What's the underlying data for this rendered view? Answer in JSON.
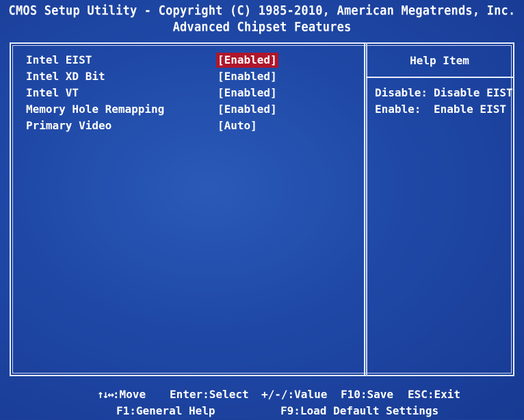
{
  "header": {
    "title_line1": "CMOS Setup Utility - Copyright (C) 1985-2010, American Megatrends, Inc.",
    "title_line2": "Advanced Chipset Features"
  },
  "menu": {
    "items": [
      {
        "label": "Intel EIST",
        "value": "[Enabled]",
        "selected": true
      },
      {
        "label": "Intel XD Bit",
        "value": "[Enabled]",
        "selected": false
      },
      {
        "label": "Intel VT",
        "value": "[Enabled]",
        "selected": false
      },
      {
        "label": "Memory Hole Remapping",
        "value": "[Enabled]",
        "selected": false
      },
      {
        "label": "Primary Video",
        "value": "[Auto]",
        "selected": false
      }
    ]
  },
  "help": {
    "title": "Help Item",
    "lines": [
      {
        "key": "Disable:",
        "text": "Disable EIST"
      },
      {
        "key": "Enable:",
        "text": "Enable EIST"
      }
    ]
  },
  "footer": {
    "move_arrows": "↑↓↔",
    "move": ":Move",
    "enter": "Enter:Select",
    "value": "+/-/:Value",
    "save": "F10:Save",
    "exit": "ESC:Exit",
    "help": "F1:General Help",
    "defaults": "F9:Load Default Settings"
  },
  "colors": {
    "background": "#1f48a6",
    "highlight": "#b0162b",
    "text": "#ffffff"
  }
}
